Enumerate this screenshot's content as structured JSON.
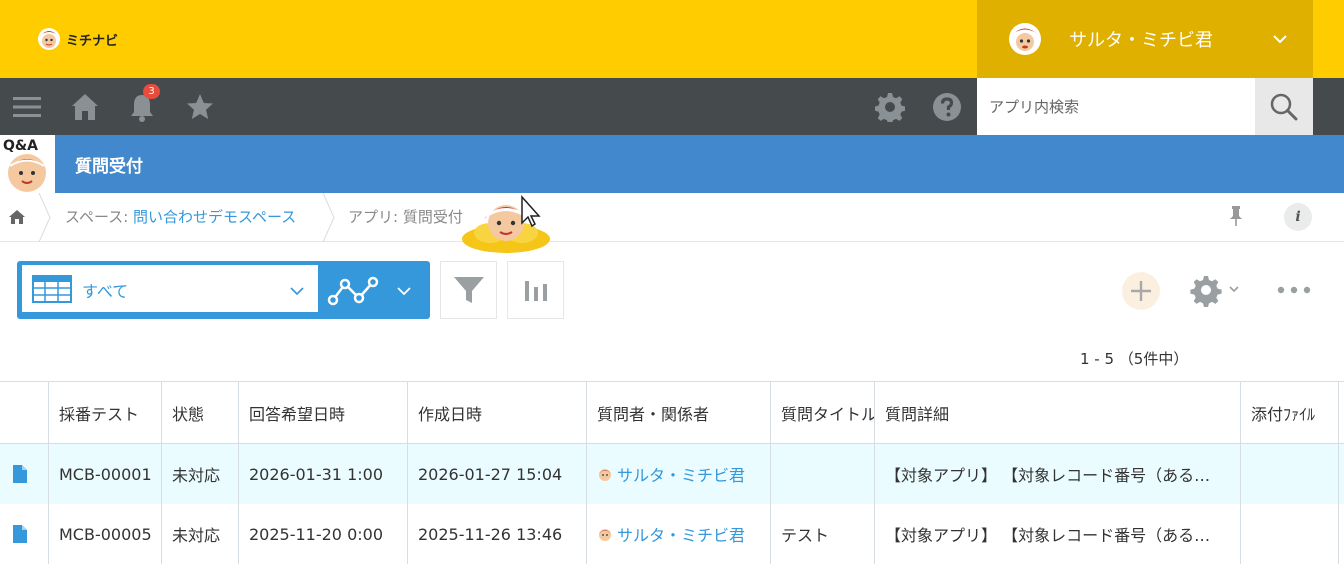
{
  "header": {
    "logo_text": "ミチナビ",
    "user_name": "サルタ・ミチビ君"
  },
  "nav": {
    "notification_count": "3",
    "search_placeholder": "アプリ内検索"
  },
  "app": {
    "title": "質問受付",
    "icon_text": "Q&A"
  },
  "breadcrumb": {
    "space_label": "スペース: ",
    "space_name": "問い合わせデモスペース",
    "app_label": "アプリ: 質問受付"
  },
  "toolbar": {
    "view_name": "すべて",
    "info_label": "i"
  },
  "pager": "1 - 5 （5件中）",
  "table": {
    "columns": [
      "採番テスト",
      "状態",
      "回答希望日時",
      "作成日時",
      "質問者・関係者",
      "質問タイトル",
      "質問詳細",
      "添付ﾌｧｲﾙ"
    ],
    "rows": [
      {
        "id": "MCB-00001",
        "status": "未対応",
        "desired": "2026-01-31 1:00",
        "created": "2026-01-27 15:04",
        "user": "サルタ・ミチビ君",
        "title": "",
        "detail": "【対象アプリ】 【対象レコード番号（ある…",
        "file": ""
      },
      {
        "id": "MCB-00005",
        "status": "未対応",
        "desired": "2025-11-20 0:00",
        "created": "2025-11-26 13:46",
        "user": "サルタ・ミチビ君",
        "title": "テスト",
        "detail": "【対象アプリ】 【対象レコード番号（ある…",
        "file": ""
      }
    ]
  },
  "colors": {
    "topbar": "#ffcc00",
    "navbar": "#454a4c",
    "appheader": "#4288cc",
    "accent": "#3498db"
  },
  "icons": [
    "menu-icon",
    "home-icon",
    "bell-icon",
    "star-icon",
    "gear-icon",
    "help-icon",
    "search-icon",
    "pin-icon",
    "info-icon",
    "table-view-icon",
    "graph-icon",
    "filter-icon",
    "chart-icon",
    "plus-icon",
    "more-icon",
    "document-icon"
  ]
}
